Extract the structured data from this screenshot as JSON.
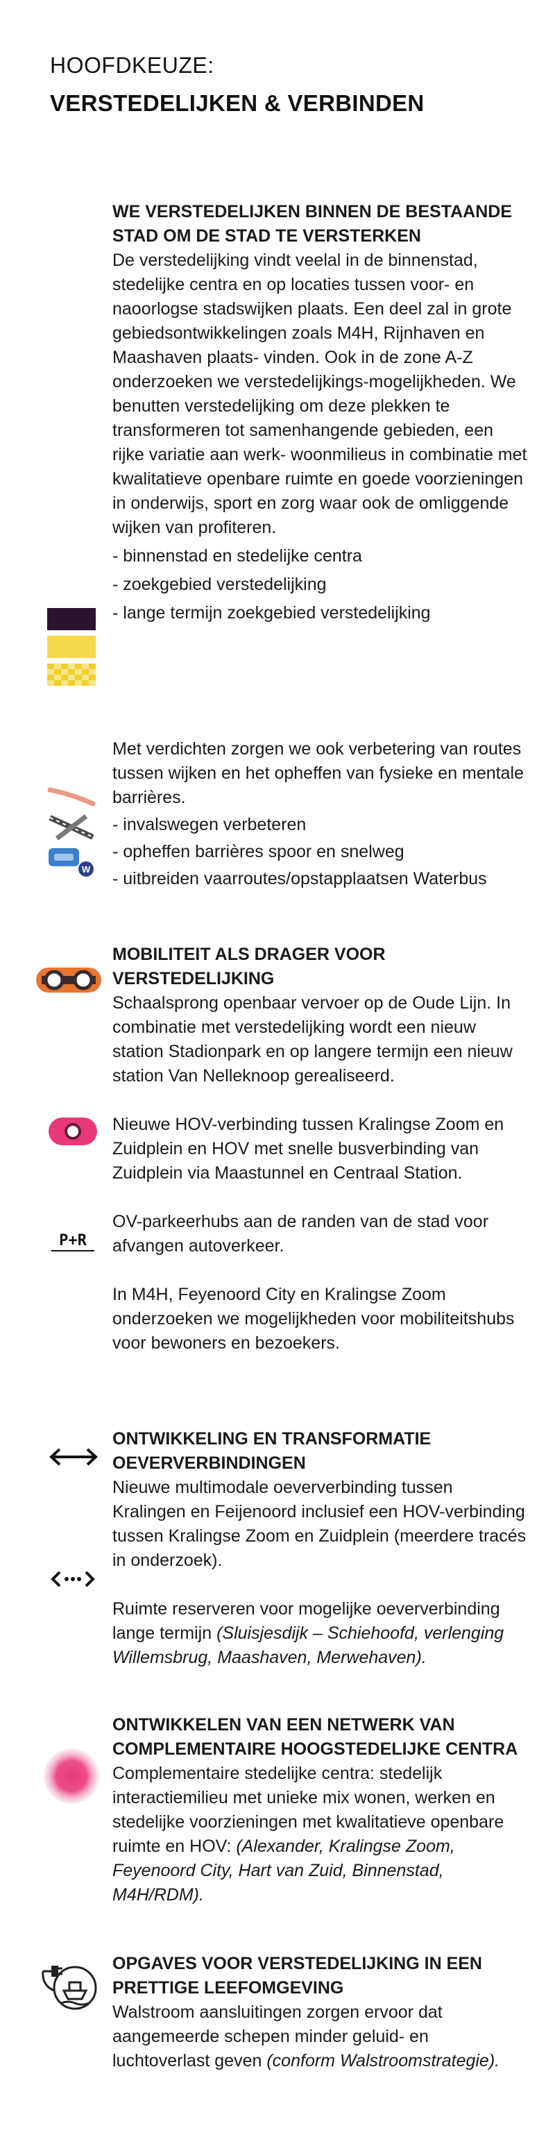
{
  "header": {
    "kicker": "HOOFDKEUZE:",
    "title": "VERSTEDELIJKEN & VERBINDEN"
  },
  "sections": {
    "s1": {
      "heading": "WE VERSTEDELIJKEN BINNEN DE BESTAANDE STAD OM DE STAD TE VERSTERKEN",
      "body": "De verstedelijking vindt veelal in de binnenstad, stedelijke centra en op locaties tussen voor- en naoorlogse stadswijken plaats. Een deel zal in grote gebiedsontwikkelingen zoals M4H, Rijnhaven en Maashaven plaats- vinden. Ook in de zone A-Z onderzoeken we verstedelijkings-mogelijkheden. We benutten verstedelijking om deze plekken te transformeren tot samenhangende gebieden, een rijke variatie aan werk- woonmilieus in combinatie met kwalitatieve openbare ruimte en goede voorzieningen in onderwijs, sport en zorg waar ook de omliggende wijken van profiteren.",
      "legend": [
        "- binnenstad en stedelijke centra",
        "- zoekgebied verstedelijking",
        "- lange termijn zoekgebied verstedelijking"
      ]
    },
    "s2": {
      "body": "Met verdichten zorgen we ook verbetering van routes tussen wijken en het opheffen van fysieke en mentale barrières.",
      "legend": [
        "- invalswegen verbeteren",
        "- opheffen barrières spoor en snelweg",
        "- uitbreiden vaarroutes/opstapplaatsen Waterbus"
      ]
    },
    "s3": {
      "heading": "MOBILITEIT ALS DRAGER VOOR VERSTEDELIJKING",
      "body1": "Schaalsprong openbaar vervoer op de Oude Lijn. In combinatie met verstedelijking wordt een nieuw station Stadionpark en op langere termijn een nieuw station Van Nelleknoop gerealiseerd.",
      "body2": "Nieuwe HOV-verbinding tussen Kralingse Zoom en Zuidplein en HOV met snelle busverbinding van Zuidplein via Maastunnel en Centraal Station.",
      "pr_label": "P+R",
      "body3": "OV-parkeerhubs aan de randen van de stad voor afvangen autoverkeer.",
      "body4": "In M4H, Feyenoord City en Kralingse Zoom onderzoeken we mogelijkheden voor mobiliteitshubs voor bewoners en bezoekers."
    },
    "s4": {
      "heading": "ONTWIKKELING EN TRANSFORMATIE OEVERVERBINDINGEN",
      "body1": "Nieuwe multimodale oeververbinding tussen Kralingen en Feijenoord inclusief een HOV-verbinding tussen Kralingse Zoom en Zuidplein (meerdere tracés in onderzoek).",
      "body2_plain": "Ruimte reserveren voor mogelijke oeververbinding lange termijn ",
      "body2_italic": "(Sluisjesdijk – Schiehoofd, verlenging Willemsbrug, Maashaven, Merwehaven)."
    },
    "s5": {
      "heading": "ONTWIKKELEN VAN EEN NETWERK VAN COMPLEMENTAIRE HOOGSTEDELIJKE CENTRA",
      "body_plain": "Complementaire stedelijke centra: stedelijk interactiemilieu met unieke mix wonen, werken en stedelijke voorzieningen met kwalitatieve openbare ruimte en HOV:",
      "body_italic": "(Alexander, Kralingse Zoom, Feyenoord City, Hart van Zuid, Binnenstad, M4H/RDM)."
    },
    "s6": {
      "heading": "OPGAVES VOOR VERSTEDELIJKING IN EEN PRETTIGE LEEFOMGEVING",
      "body_plain": "Walstroom aansluitingen zorgen ervoor dat aangemeerde schepen minder geluid- en luchtoverlast geven ",
      "body_italic": "(conform Walstroomstrategie)."
    }
  },
  "colors": {
    "dark_purple": "#2a1430",
    "yellow": "#f6d94a",
    "orange": "#e8752f",
    "pink": "#e8397a",
    "salmon": "#e99a86",
    "blue": "#3a7fc7",
    "grey": "#4a4a4a"
  },
  "icons": [
    "city-center-swatch",
    "search-area-swatch",
    "long-term-search-swatch",
    "approach-road-icon",
    "barrier-removal-icon",
    "waterbus-icon",
    "metro-line-icon",
    "hov-bus-icon",
    "park-and-ride-icon",
    "crossing-arrow-icon",
    "future-crossing-icon",
    "urban-center-icon",
    "shore-power-icon"
  ]
}
